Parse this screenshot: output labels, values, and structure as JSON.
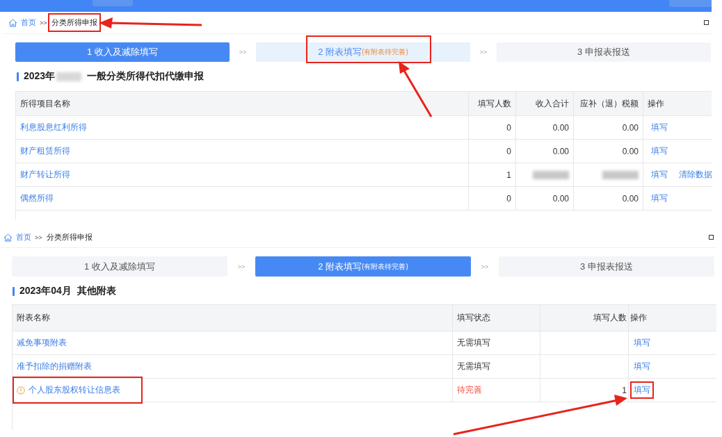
{
  "panels": [
    {
      "breadcrumb": {
        "home": "首页",
        "separator": ">>",
        "current": "分类所得申报",
        "highlighted": true
      },
      "steps": [
        {
          "label": "1 收入及减除填写",
          "selected": true
        },
        {
          "label": "2 附表填写",
          "note": "(有附表待完善)",
          "selected": false,
          "enabled": true,
          "highlighted": true
        },
        {
          "label": "3 申报表报送",
          "selected": false,
          "enabled": false
        }
      ],
      "step_separators": [
        ">>",
        ">>"
      ],
      "heading": {
        "prefix": "2023年",
        "blurred": true,
        "suffix": "一般分类所得代扣代缴申报"
      },
      "table": {
        "columns": [
          "所得项目名称",
          "填写人数",
          "收入合计",
          "应补（退）税额",
          "操作"
        ],
        "rows": [
          {
            "cells": [
              {
                "kind": "link",
                "text": "利息股息红利所得"
              },
              {
                "kind": "text",
                "text": "0"
              },
              {
                "kind": "text",
                "text": "0.00"
              },
              {
                "kind": "text",
                "text": "0.00"
              },
              {
                "kind": "actions",
                "actions": [
                  {
                    "text": "填写",
                    "highlighted": false
                  }
                ]
              }
            ]
          },
          {
            "cells": [
              {
                "kind": "link",
                "text": "财产租赁所得"
              },
              {
                "kind": "text",
                "text": "0"
              },
              {
                "kind": "text",
                "text": "0.00"
              },
              {
                "kind": "text",
                "text": "0.00"
              },
              {
                "kind": "actions",
                "actions": [
                  {
                    "text": "填写",
                    "highlighted": false
                  }
                ]
              }
            ]
          },
          {
            "cells": [
              {
                "kind": "link",
                "text": "财产转让所得"
              },
              {
                "kind": "text",
                "text": "1"
              },
              {
                "kind": "blurred"
              },
              {
                "kind": "blurred"
              },
              {
                "kind": "actions",
                "actions": [
                  {
                    "text": "填写",
                    "highlighted": false
                  },
                  {
                    "text": "清除数据",
                    "highlighted": false
                  }
                ]
              }
            ]
          },
          {
            "cells": [
              {
                "kind": "link",
                "text": "偶然所得"
              },
              {
                "kind": "text",
                "text": "0"
              },
              {
                "kind": "text",
                "text": "0.00"
              },
              {
                "kind": "text",
                "text": "0.00"
              },
              {
                "kind": "actions",
                "actions": [
                  {
                    "text": "填写",
                    "highlighted": false
                  }
                ]
              }
            ]
          }
        ]
      }
    },
    {
      "breadcrumb": {
        "home": "首页",
        "separator": ">>",
        "current": "分类所得申报",
        "highlighted": false
      },
      "steps": [
        {
          "label": "1 收入及减除填写",
          "selected": false,
          "enabled": false
        },
        {
          "label": "2 附表填写",
          "note": "(有附表待完善)",
          "selected": true
        },
        {
          "label": "3 申报表报送",
          "selected": false,
          "enabled": false
        }
      ],
      "step_separators": [
        ">>",
        ">>"
      ],
      "heading": {
        "prefix": "2023年04月",
        "suffix": "其他附表"
      },
      "table": {
        "columns": [
          "附表名称",
          "填写状态",
          "填写人数",
          "操作"
        ],
        "rows": [
          {
            "cells": [
              {
                "kind": "link",
                "text": "减免事项附表"
              },
              {
                "kind": "text",
                "text": "无需填写"
              },
              {
                "kind": "empty"
              },
              {
                "kind": "actions",
                "actions": [
                  {
                    "text": "填写",
                    "highlighted": false
                  }
                ]
              }
            ]
          },
          {
            "cells": [
              {
                "kind": "link",
                "text": "准予扣除的捐赠附表"
              },
              {
                "kind": "text",
                "text": "无需填写"
              },
              {
                "kind": "empty"
              },
              {
                "kind": "actions",
                "actions": [
                  {
                    "text": "填写",
                    "highlighted": false
                  }
                ]
              }
            ]
          },
          {
            "warning": true,
            "highlighted": true,
            "cells": [
              {
                "kind": "link",
                "text": "个人股东股权转让信息表"
              },
              {
                "kind": "alert",
                "text": "待完善"
              },
              {
                "kind": "text",
                "text": "1"
              },
              {
                "kind": "actions",
                "actions": [
                  {
                    "text": "填写",
                    "highlighted": true
                  }
                ]
              }
            ]
          }
        ]
      }
    }
  ]
}
